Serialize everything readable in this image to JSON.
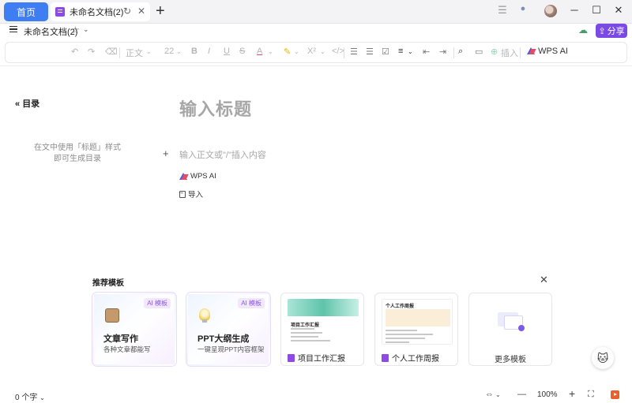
{
  "tabs": {
    "home_label": "首页",
    "doc_label": "未命名文档(2)"
  },
  "docbar": {
    "doc_name": "未命名文档(2)",
    "share_label": "分享"
  },
  "toolbar": {
    "style_label": "正文",
    "font_size": "22",
    "insert_label": "插入",
    "wps_ai_label": "WPS AI"
  },
  "sidebar": {
    "toc_label": "目录",
    "toc_hint_line1": "在文中使用「标题」样式",
    "toc_hint_line2": "即可生成目录"
  },
  "editor": {
    "title_placeholder": "输入标题",
    "body_placeholder": "输入正文或\"/\"插入内容",
    "wps_ai_label": "WPS AI",
    "import_label": "导入"
  },
  "templates": {
    "heading": "推荐模板",
    "cards": [
      {
        "badge": "AI 模板",
        "title": "文章写作",
        "subtitle": "各种文章都能写"
      },
      {
        "badge": "AI 模板",
        "title": "PPT大纲生成",
        "subtitle": "一键呈现PPT内容框架"
      },
      {
        "label": "项目工作汇报",
        "thumb_title": "项目工作汇报"
      },
      {
        "label": "个人工作周报",
        "thumb_title": "个人工作周报"
      },
      {
        "label": "更多模板"
      }
    ]
  },
  "status": {
    "word_count": "0 个字",
    "zoom": "100%"
  },
  "colors": {
    "accent_blue": "#3f7df2",
    "accent_purple": "#7b4ae5"
  }
}
